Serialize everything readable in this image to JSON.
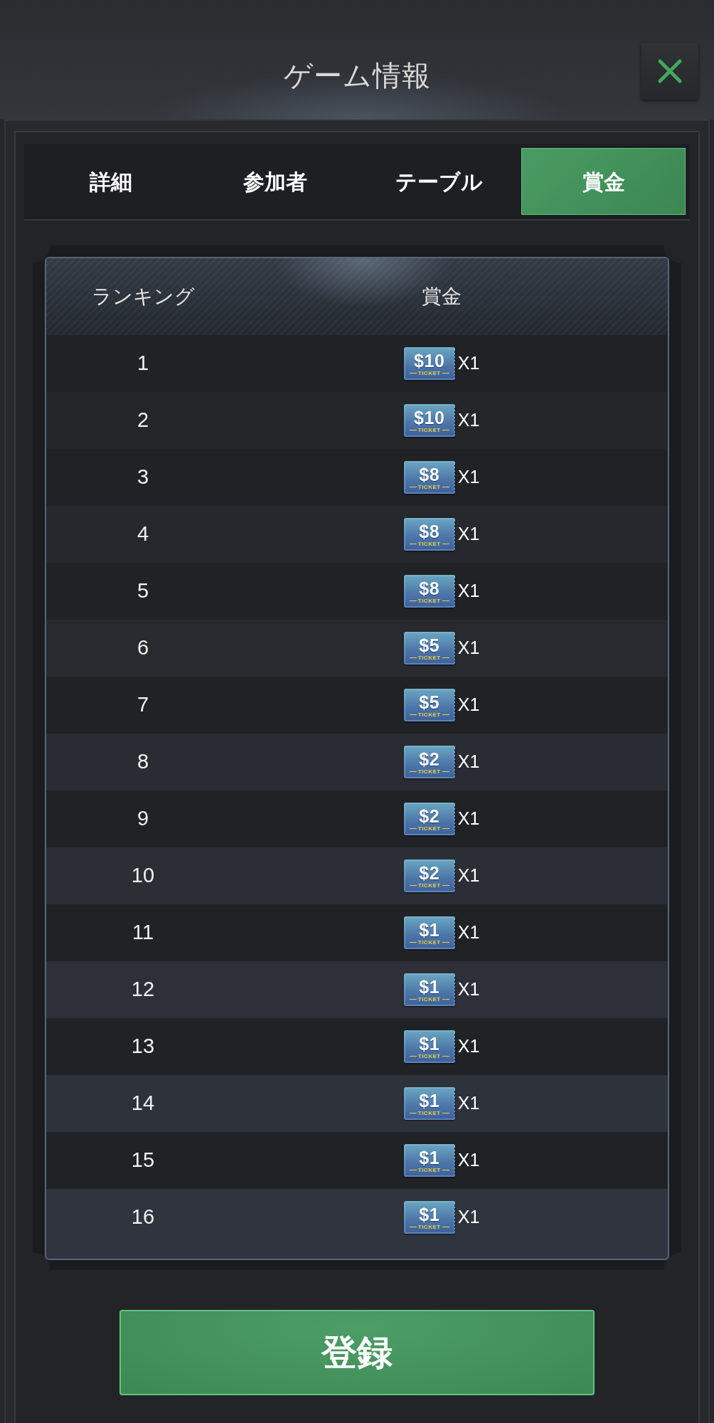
{
  "header": {
    "title": "ゲーム情報"
  },
  "tabs": [
    {
      "label": "詳細",
      "selected": false
    },
    {
      "label": "参加者",
      "selected": false
    },
    {
      "label": "テーブル",
      "selected": false
    },
    {
      "label": "賞金",
      "selected": true
    }
  ],
  "table": {
    "columns": [
      "ランキング",
      "賞金"
    ],
    "rows": [
      {
        "rank": "1",
        "ticket_amount": "$10",
        "ticket_label": "TICKET",
        "quantity": "X1"
      },
      {
        "rank": "2",
        "ticket_amount": "$10",
        "ticket_label": "TICKET",
        "quantity": "X1"
      },
      {
        "rank": "3",
        "ticket_amount": "$8",
        "ticket_label": "TICKET",
        "quantity": "X1"
      },
      {
        "rank": "4",
        "ticket_amount": "$8",
        "ticket_label": "TICKET",
        "quantity": "X1"
      },
      {
        "rank": "5",
        "ticket_amount": "$8",
        "ticket_label": "TICKET",
        "quantity": "X1"
      },
      {
        "rank": "6",
        "ticket_amount": "$5",
        "ticket_label": "TICKET",
        "quantity": "X1"
      },
      {
        "rank": "7",
        "ticket_amount": "$5",
        "ticket_label": "TICKET",
        "quantity": "X1"
      },
      {
        "rank": "8",
        "ticket_amount": "$2",
        "ticket_label": "TICKET",
        "quantity": "X1"
      },
      {
        "rank": "9",
        "ticket_amount": "$2",
        "ticket_label": "TICKET",
        "quantity": "X1"
      },
      {
        "rank": "10",
        "ticket_amount": "$2",
        "ticket_label": "TICKET",
        "quantity": "X1"
      },
      {
        "rank": "11",
        "ticket_amount": "$1",
        "ticket_label": "TICKET",
        "quantity": "X1"
      },
      {
        "rank": "12",
        "ticket_amount": "$1",
        "ticket_label": "TICKET",
        "quantity": "X1"
      },
      {
        "rank": "13",
        "ticket_amount": "$1",
        "ticket_label": "TICKET",
        "quantity": "X1"
      },
      {
        "rank": "14",
        "ticket_amount": "$1",
        "ticket_label": "TICKET",
        "quantity": "X1"
      },
      {
        "rank": "15",
        "ticket_amount": "$1",
        "ticket_label": "TICKET",
        "quantity": "X1"
      },
      {
        "rank": "16",
        "ticket_amount": "$1",
        "ticket_label": "TICKET",
        "quantity": "X1"
      }
    ]
  },
  "register_button": {
    "label": "登録"
  }
}
